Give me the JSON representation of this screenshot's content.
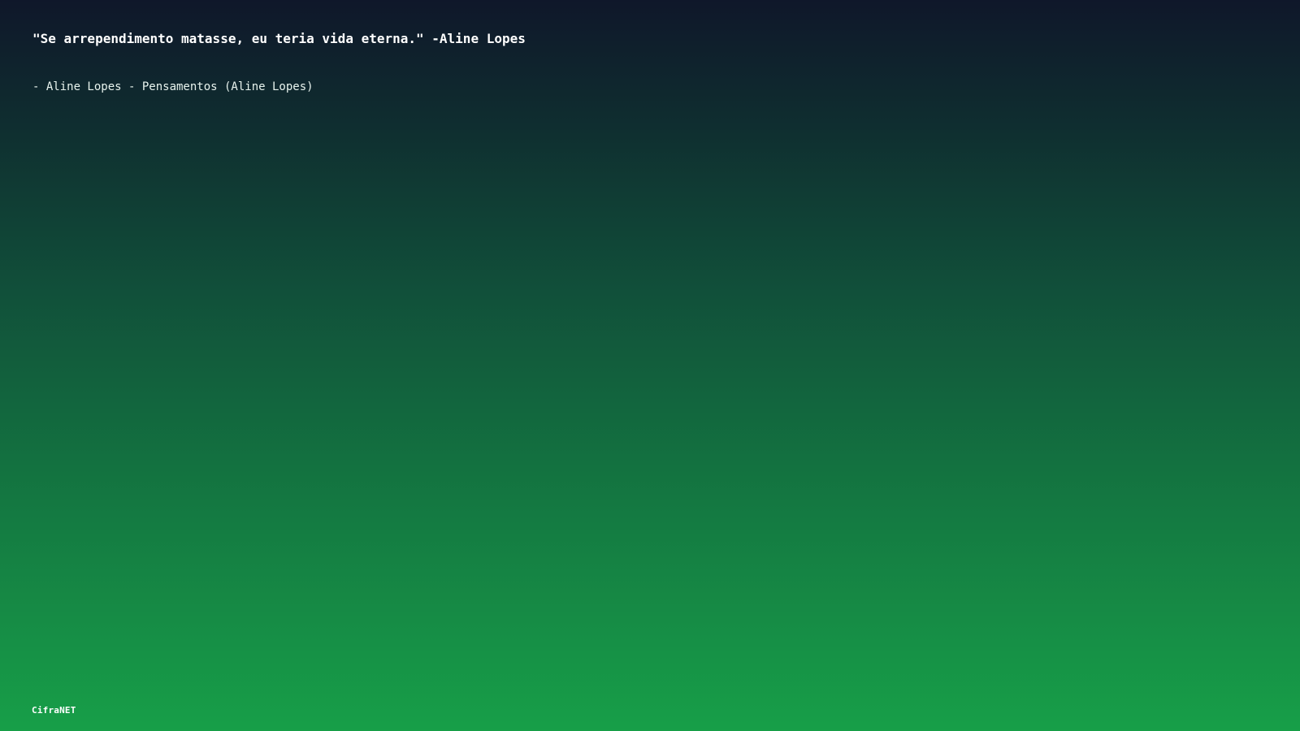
{
  "content": {
    "quote": "\"Se arrependimento matasse, eu teria vida eterna.\" -Aline Lopes",
    "attribution": "- Aline Lopes - Pensamentos (Aline Lopes)"
  },
  "footer": {
    "brand": "CifraNET"
  },
  "colors": {
    "gradient_top": "#0f172a",
    "gradient_bottom": "#179f48",
    "text": "#ffffff"
  }
}
